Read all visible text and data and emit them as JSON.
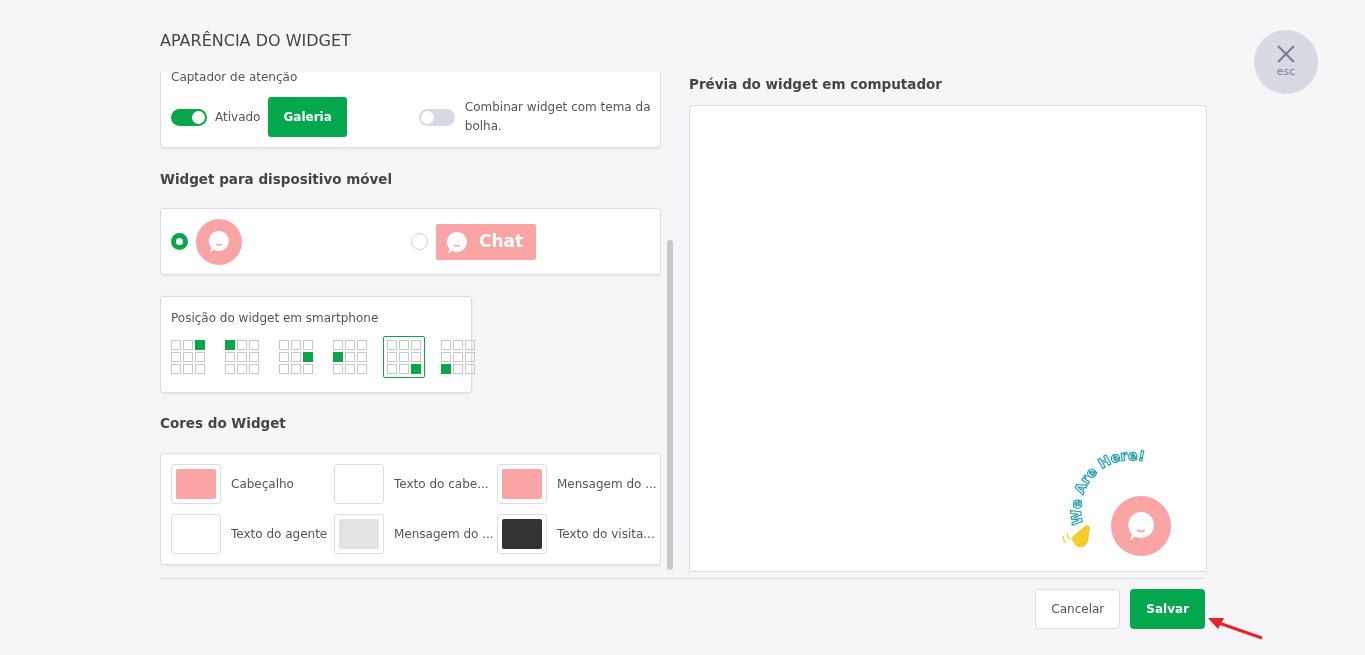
{
  "title": "APARÊNCIA DO WIDGET",
  "close_button": {
    "label": "esc"
  },
  "attention": {
    "title": "Captador de atenção",
    "toggle": {
      "label": "Ativado",
      "on": true
    },
    "gallery_button": "Galeria",
    "combine_toggle": {
      "label": "Combinar widget com tema da bolha.",
      "on": false
    }
  },
  "mobile_widget": {
    "heading": "Widget para dispositivo móvel",
    "options": [
      {
        "kind": "bubble",
        "selected": true
      },
      {
        "kind": "chat-button",
        "label": "Chat",
        "selected": false
      }
    ]
  },
  "position": {
    "title": "Posição do widget em smartphone",
    "options": [
      {
        "kind": "topright",
        "selected": false
      },
      {
        "kind": "topleft",
        "selected": false
      },
      {
        "kind": "middleright",
        "selected": false
      },
      {
        "kind": "middleleft",
        "selected": false
      },
      {
        "kind": "bottomright",
        "selected": true
      },
      {
        "kind": "bottomleft",
        "selected": false
      }
    ]
  },
  "colors": {
    "heading": "Cores do Widget",
    "items": [
      {
        "label": "Cabeçalho",
        "color": "#fba4a6"
      },
      {
        "label": "Texto do cabe...",
        "color": "#ffffff"
      },
      {
        "label": "Mensagem do ...",
        "color": "#fba4a6"
      },
      {
        "label": "Texto do agente",
        "color": "#ffffff"
      },
      {
        "label": "Mensagem do ...",
        "color": "#e3e3e3"
      },
      {
        "label": "Texto do visita...",
        "color": "#333333"
      }
    ]
  },
  "preview": {
    "heading": "Prévia do widget em computador",
    "badge_text": "We Are Here!"
  },
  "buttons": [
    {
      "kind": "secondary",
      "label": "Cancelar"
    },
    {
      "kind": "primary",
      "label": "Salvar"
    }
  ]
}
